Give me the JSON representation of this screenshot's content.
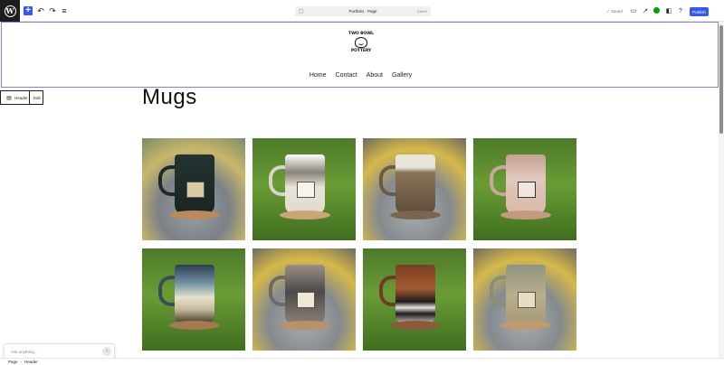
{
  "toolbar": {
    "add_icon": "plus-icon",
    "undo_icon": "undo-icon",
    "redo_icon": "redo-icon",
    "document_overview_icon": "list-view-icon",
    "document_title": "Portfolio · Page",
    "shortcut": "Ctrl+K",
    "saved_label": "✓ Saved",
    "publish_label": "Publish"
  },
  "header": {
    "logo_lines": [
      "TWO BOWL",
      "POTTERY"
    ],
    "nav": [
      "Home",
      "Contact",
      "About",
      "Gallery"
    ]
  },
  "block_toolbar": {
    "block_name": "Header",
    "edit_label": "Edit"
  },
  "content": {
    "heading": "Mugs",
    "gallery": [
      {
        "alt": "dark green mug with stick figure panel",
        "setting": "wheel"
      },
      {
        "alt": "white mug with No Weenies Allowed panel",
        "setting": "grass"
      },
      {
        "alt": "textured bronze mug",
        "setting": "wheel"
      },
      {
        "alt": "pink mug with MAMA badge",
        "setting": "grass"
      },
      {
        "alt": "blue and cream drip glaze mug",
        "setting": "grass"
      },
      {
        "alt": "grey speckled mug with panel",
        "setting": "wheel"
      },
      {
        "alt": "brown and black striped mug",
        "setting": "grass"
      },
      {
        "alt": "sage mug with stamped panel",
        "setting": "wheel"
      }
    ]
  },
  "assistant": {
    "placeholder": "Ask anything..."
  },
  "breadcrumbs": [
    "Page",
    "Header"
  ],
  "colors": {
    "accent": "#3858e9",
    "block_outline": "#8b7cd9",
    "jetpack": "#069e08"
  }
}
